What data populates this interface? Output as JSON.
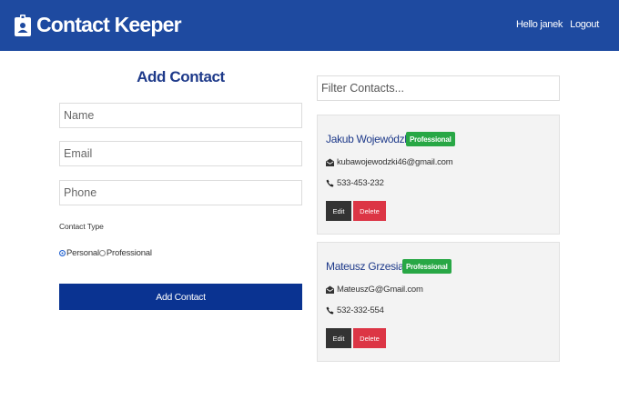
{
  "navbar": {
    "brand": "Contact Keeper",
    "brand_icon": "id-badge-icon",
    "greeting": "Hello janek",
    "logout": "Logout",
    "color": "#1e4aa0"
  },
  "form": {
    "title": "Add Contact",
    "name_placeholder": "Name",
    "email_placeholder": "Email",
    "phone_placeholder": "Phone",
    "type_label": "Contact Type",
    "options": [
      "Personal",
      "Professional"
    ],
    "selected_option": "Personal",
    "submit_label": "Add Contact",
    "submit_color": "#0a3391"
  },
  "filter": {
    "placeholder": "Filter Contacts..."
  },
  "contacts": [
    {
      "name": "Jakub Wojewódzki",
      "type": "Professional",
      "email": "kubawojewodzki46@gmail.com",
      "phone": "533-453-232",
      "edit_label": "Edit",
      "delete_label": "Delete"
    },
    {
      "name": "Mateusz Grzesiak",
      "type": "Professional",
      "email": "MateuszG@Gmail.com",
      "phone": "532-332-554",
      "edit_label": "Edit",
      "delete_label": "Delete"
    }
  ],
  "colors": {
    "badge": "#28a745",
    "delete": "#dc3545",
    "edit": "#333333"
  }
}
